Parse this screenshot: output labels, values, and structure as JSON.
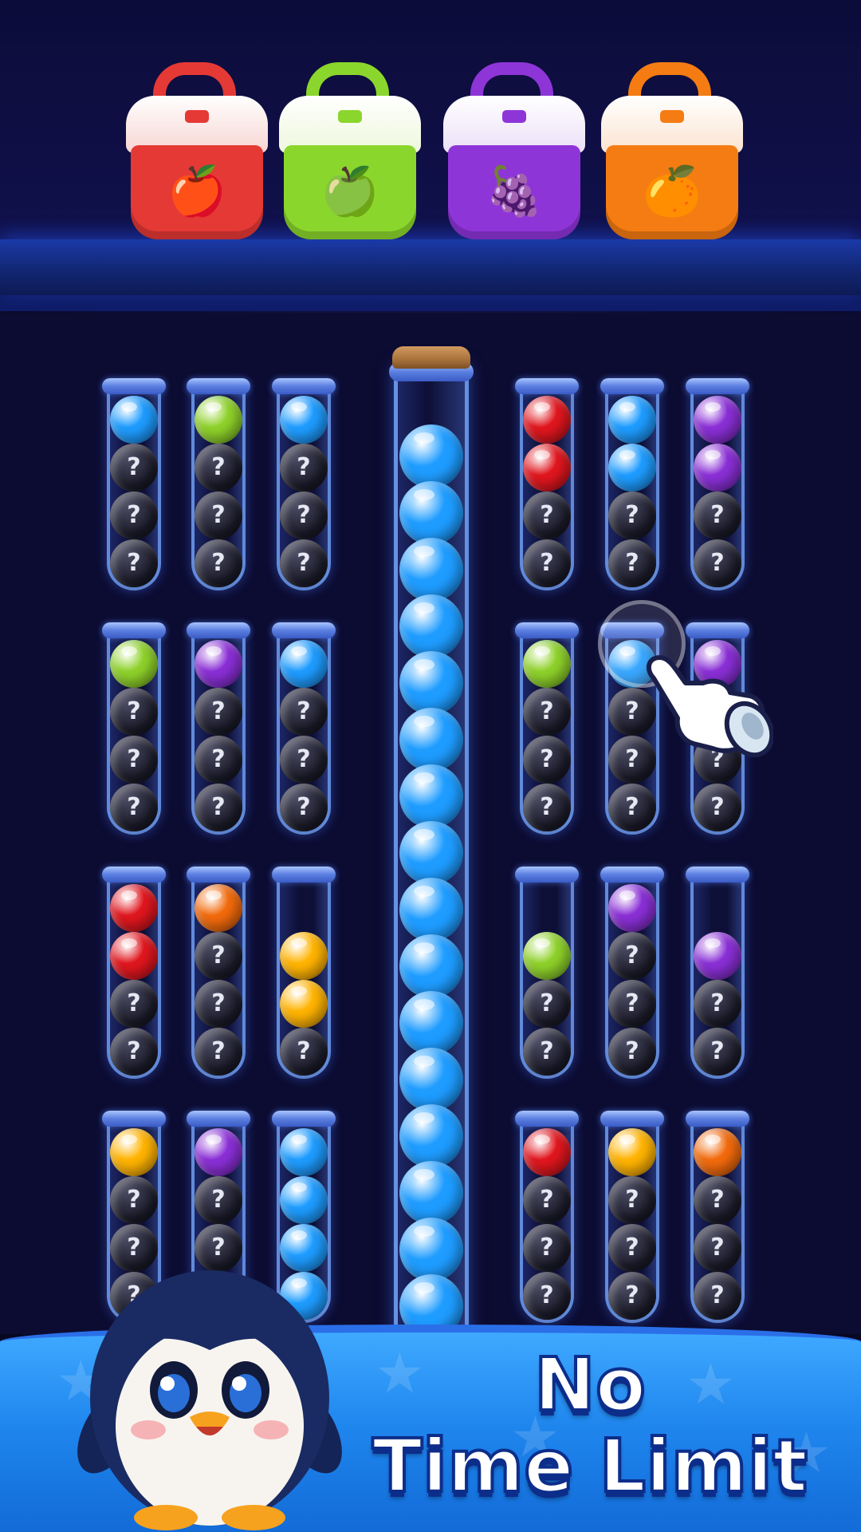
{
  "bags": [
    {
      "color": "#e53935",
      "lid": "#f7d6d2",
      "handle": "#e53935",
      "fruit": "apple",
      "emoji": "🍎"
    },
    {
      "color": "#8bd62c",
      "lid": "#eef7dc",
      "handle": "#8bd62c",
      "fruit": "green-apple",
      "emoji": "🍏"
    },
    {
      "color": "#8e35d8",
      "lid": "#ece0f8",
      "handle": "#8e35d8",
      "fruit": "grapes",
      "emoji": "🍇"
    },
    {
      "color": "#f57c12",
      "lid": "#fbe3cf",
      "handle": "#f57c12",
      "fruit": "orange",
      "emoji": "🍊"
    }
  ],
  "colors": {
    "blue": "#1e9cff",
    "green": "#8ed12a",
    "purple": "#8a2fd6",
    "red": "#e0161e",
    "orange": "#f26a0c",
    "yellow": "#ffb300",
    "banner": "#1f86ee",
    "title_stroke": "#0d2d8a"
  },
  "hidden_glyph": "?",
  "tubes": [
    [
      "blue",
      "?",
      "?",
      "?"
    ],
    [
      "green",
      "?",
      "?",
      "?"
    ],
    [
      "blue",
      "?",
      "?",
      "?"
    ],
    [
      "red",
      "red",
      "?",
      "?"
    ],
    [
      "blue",
      "blue",
      "?",
      "?"
    ],
    [
      "purple",
      "purple",
      "?",
      "?"
    ],
    [
      "green",
      "?",
      "?",
      "?"
    ],
    [
      "purple",
      "?",
      "?",
      "?"
    ],
    [
      "blue",
      "?",
      "?",
      "?"
    ],
    [
      "green",
      "?",
      "?",
      "?"
    ],
    [
      "blue",
      "?",
      "?",
      "?"
    ],
    [
      "purple",
      "?",
      "?",
      "?"
    ],
    [
      "red",
      "red",
      "?",
      "?"
    ],
    [
      "orange",
      "?",
      "?",
      "?"
    ],
    [
      "",
      "yellow",
      "yellow",
      "?"
    ],
    [
      "",
      "green",
      "?",
      "?"
    ],
    [
      "purple",
      "?",
      "?",
      "?"
    ],
    [
      "",
      "purple",
      "?",
      "?"
    ],
    [
      "yellow",
      "?",
      "?",
      "?"
    ],
    [
      "purple",
      "?",
      "?",
      "?"
    ],
    [
      "blue",
      "blue",
      "blue",
      "blue"
    ],
    [
      "red",
      "?",
      "?",
      "?"
    ],
    [
      "yellow",
      "?",
      "?",
      "?"
    ],
    [
      "orange",
      "?",
      "?",
      "?"
    ]
  ],
  "big_tube": {
    "color": "blue",
    "ball_count": 16
  },
  "banner": {
    "line1": "No",
    "line2": "Time Limit"
  }
}
